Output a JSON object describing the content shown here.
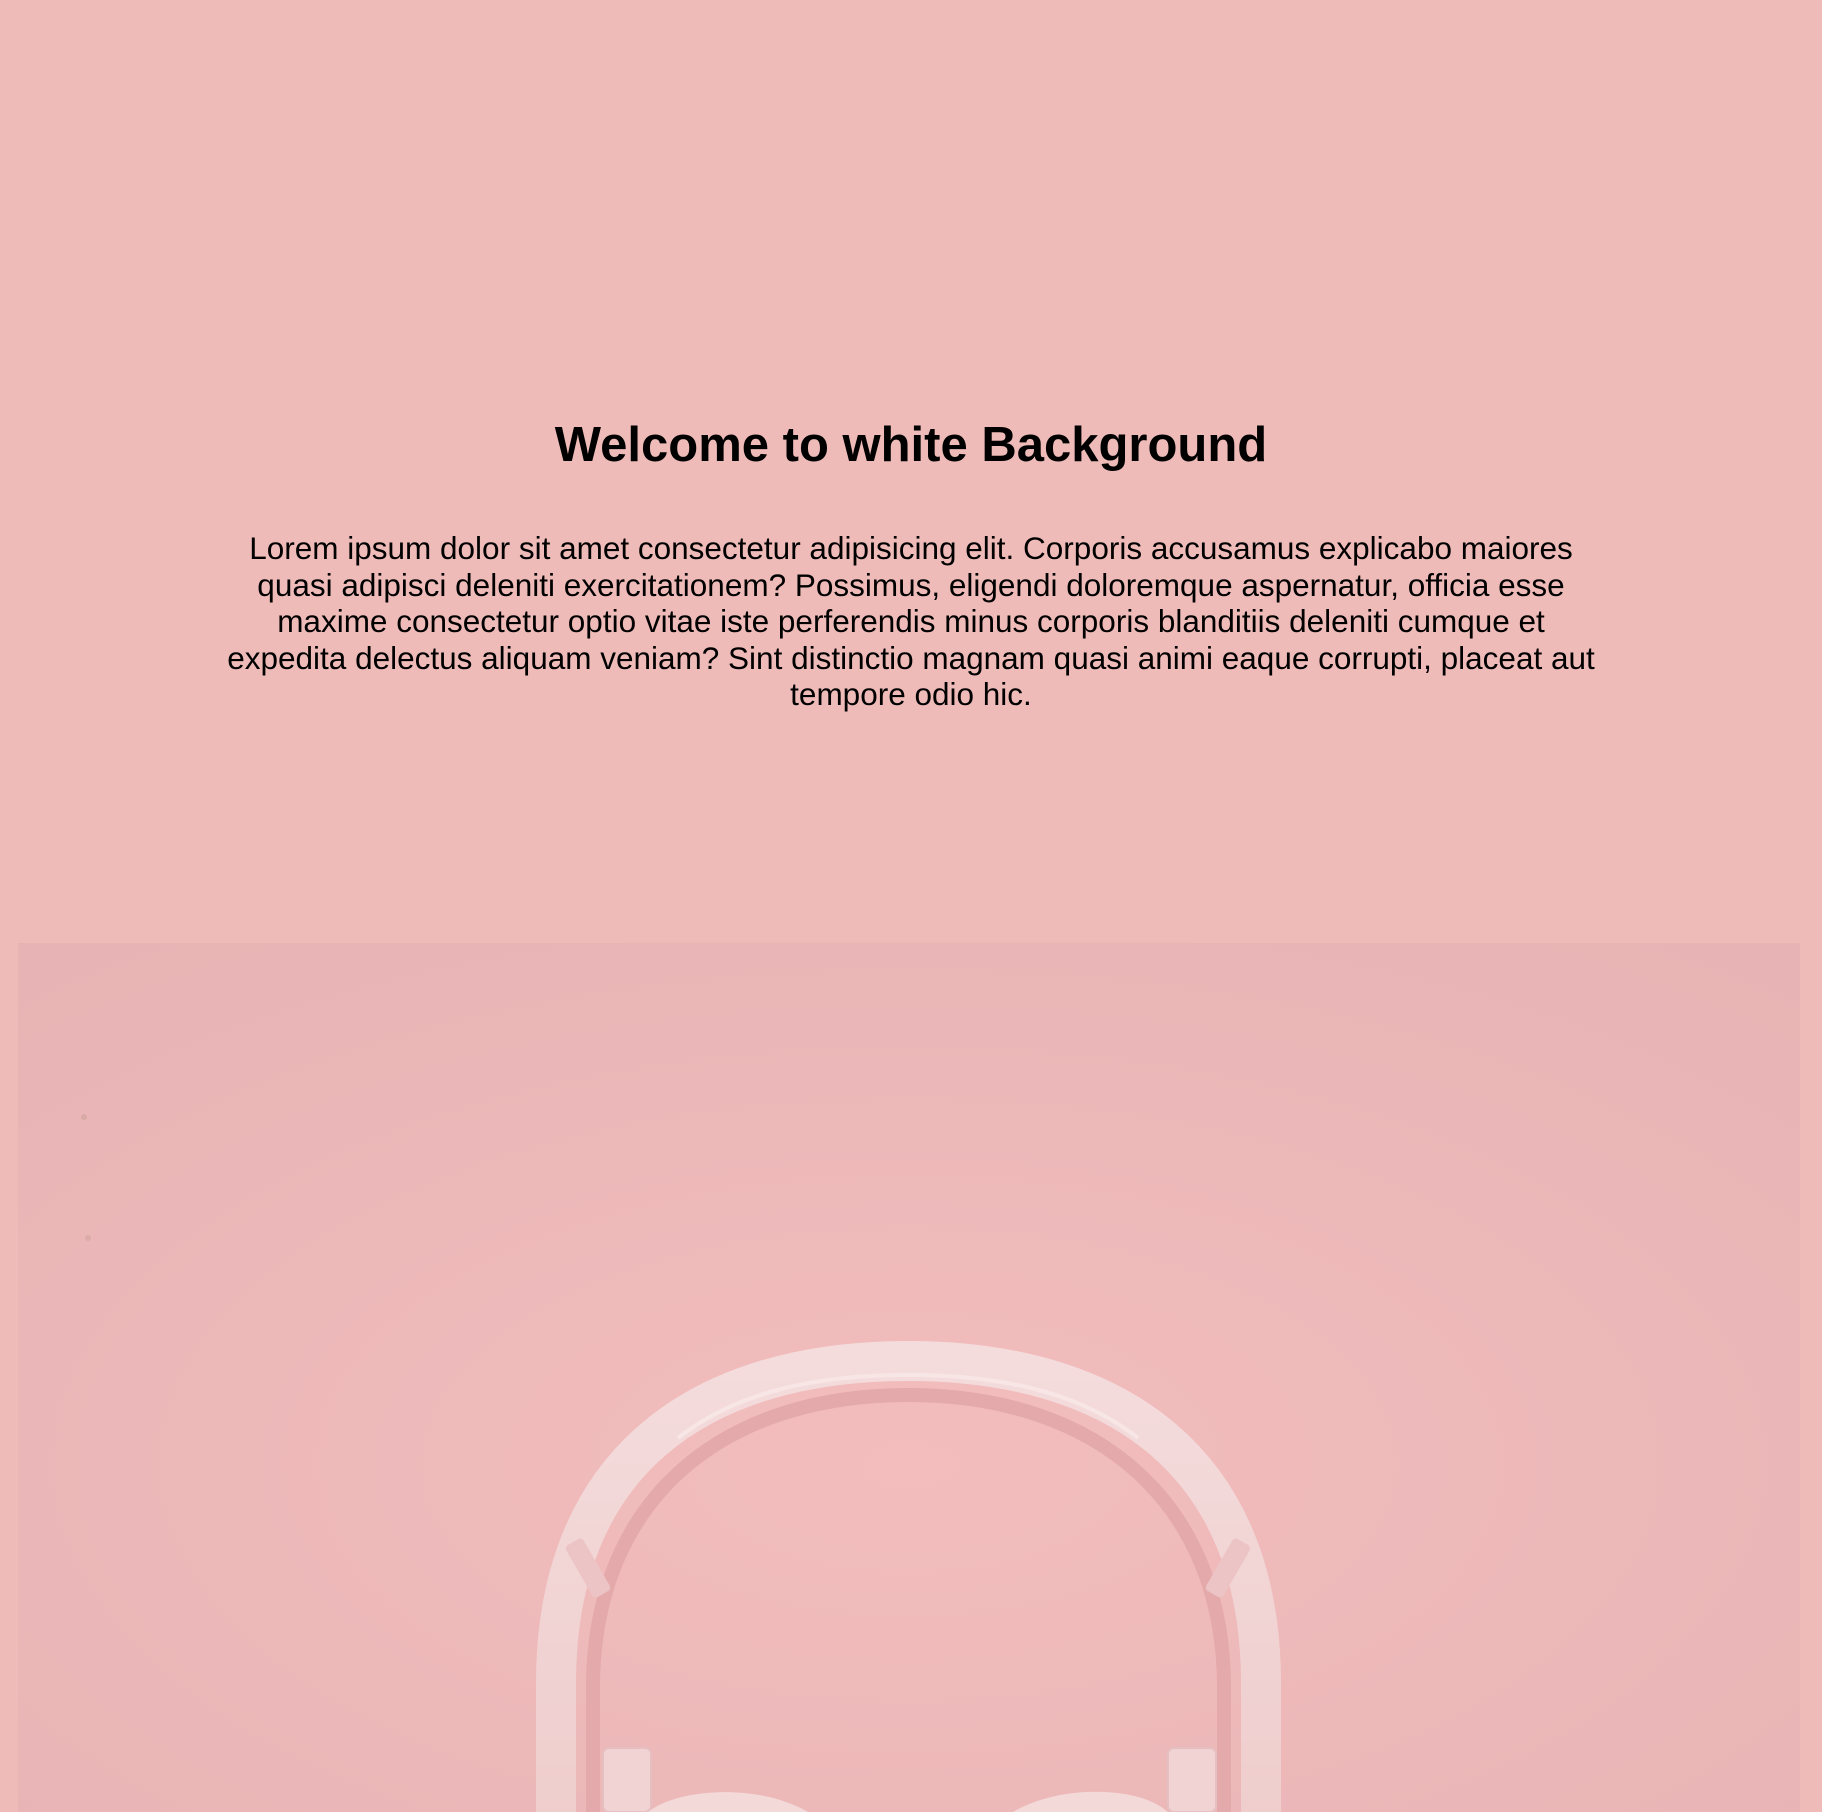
{
  "hero": {
    "title": "Welcome to white Background",
    "paragraph": "Lorem ipsum dolor sit amet consectetur adipisicing elit. Corporis accusamus explicabo maiores quasi adipisci deleniti exercitationem? Possimus, eligendi doloremque aspernatur, officia esse maxime consectetur optio vitae iste perferendis minus corporis blanditiis deleniti cumque et expedita delectus aliquam veniam? Sint distinctio magnam quasi animi eaque corrupti, placeat aut tempore odio hic."
  },
  "photo": {
    "subject": "headphones-photo"
  },
  "colors": {
    "page_background": "#eebbb8",
    "photo_background": "#eeb9b8",
    "headphone_white": "#f3d6d6",
    "text": "#000000"
  }
}
